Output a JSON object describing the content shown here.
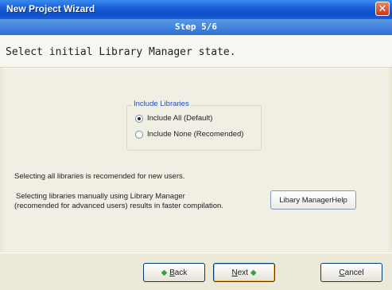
{
  "window": {
    "title": "New Project Wizard",
    "close_glyph": "✕"
  },
  "step": {
    "label": "Step 5/6"
  },
  "header": {
    "instruction": "Select initial Library Manager state."
  },
  "libraries": {
    "group_label": "Include Libraries",
    "options": [
      {
        "label": "Include All (Default)",
        "checked": true
      },
      {
        "label": "Include None (Recomended)",
        "checked": false
      }
    ]
  },
  "info": {
    "line1": "Selecting all libraries is recomended for new users.",
    "line2a": "Selecting libraries manually using Library Manager",
    "line2b": "(recomended for advanced users) results in faster compilation."
  },
  "library_manager_button": {
    "label": "Libary ManagerHelp"
  },
  "footer": {
    "back": {
      "mnemonic": "B",
      "rest": "ack",
      "arrow": "◆"
    },
    "next": {
      "mnemonic": "N",
      "rest": "ext",
      "arrow": "◆"
    },
    "cancel": {
      "mnemonic": "C",
      "rest": "ancel"
    }
  },
  "colors": {
    "title_blue": "#0d4fc9",
    "step_blue": "#2c6fd2",
    "arrow_green": "#2fa33a"
  }
}
